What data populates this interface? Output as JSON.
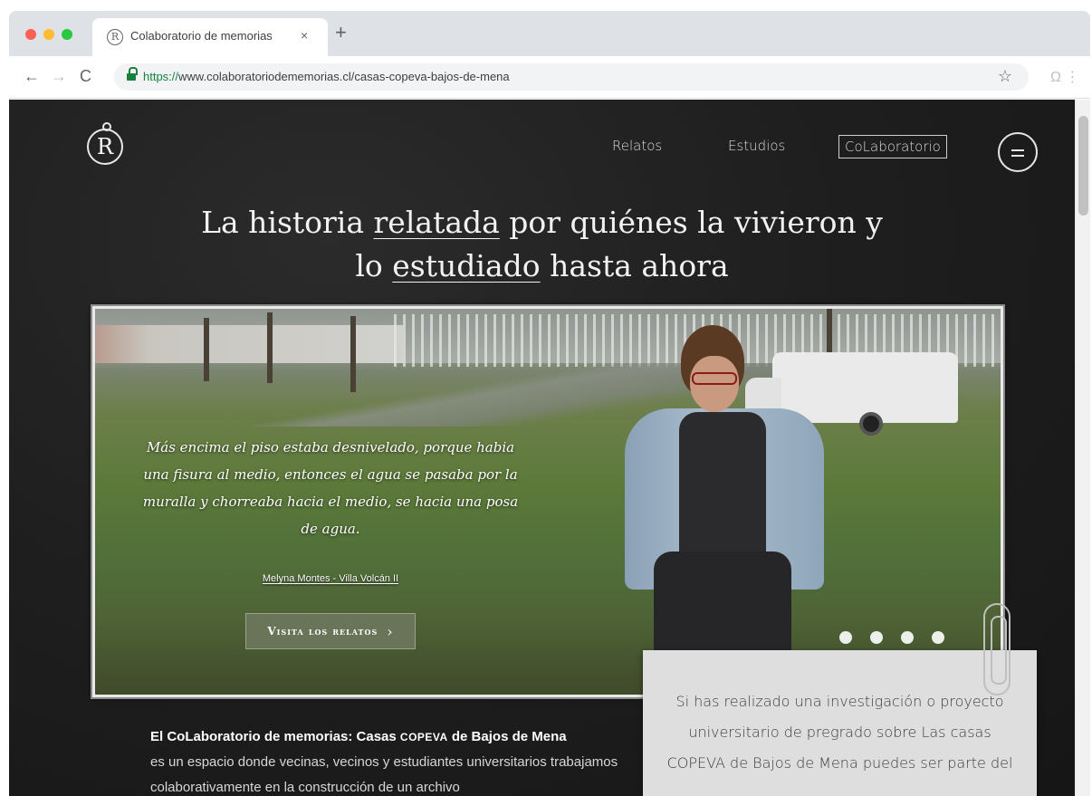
{
  "browser": {
    "tab_title": "Colaboratorio de memorias",
    "tab_close": "×",
    "new_tab": "+",
    "url_scheme": "https://",
    "url_rest": "www.colaboratoriodememorias.cl/casas-copeva-bajos-de-mena",
    "back": "←",
    "forward": "→",
    "reload": "C",
    "star": "☆",
    "profile": "Ω ⋮",
    "colors": {
      "close": "#ff5f57",
      "minimize": "#febc2e",
      "maximize": "#28c840"
    }
  },
  "site": {
    "logo_letter": "R",
    "nav": [
      "Relatos",
      "Estudios",
      "CoLaboratorio"
    ],
    "headline": {
      "p1": "La historia ",
      "u1": "relatada",
      "p2": " por quiénes la vivieron y",
      "p3": "lo ",
      "u2": "estudiado",
      "p4": " hasta ahora"
    },
    "hero": {
      "quote": "Más encima el piso estaba desnivelado, porque habia una fisura al medio, entonces el agua se pasaba por la muralla y chorreaba hacia el medio, se hacia una posa de agua.",
      "author": "Melyna Montes - Villa Volcán II",
      "cta_label": "Visita los relatos",
      "cta_chevron": "›"
    },
    "intro": {
      "title_a": "El CoLaboratorio de memorias: Casas ",
      "title_sc": "COPEVA",
      "title_b": " de Bajos de Mena",
      "body": "es un espacio donde vecinas, vecinos y estudiantes universitarios trabajamos colaborativamente en la construcción de un archivo"
    },
    "card": {
      "text": "Si has realizado una investigación o proyecto universitario de pregrado sobre Las casas COPEVA de Bajos de Mena puedes ser parte del"
    },
    "accent": "#697458"
  }
}
